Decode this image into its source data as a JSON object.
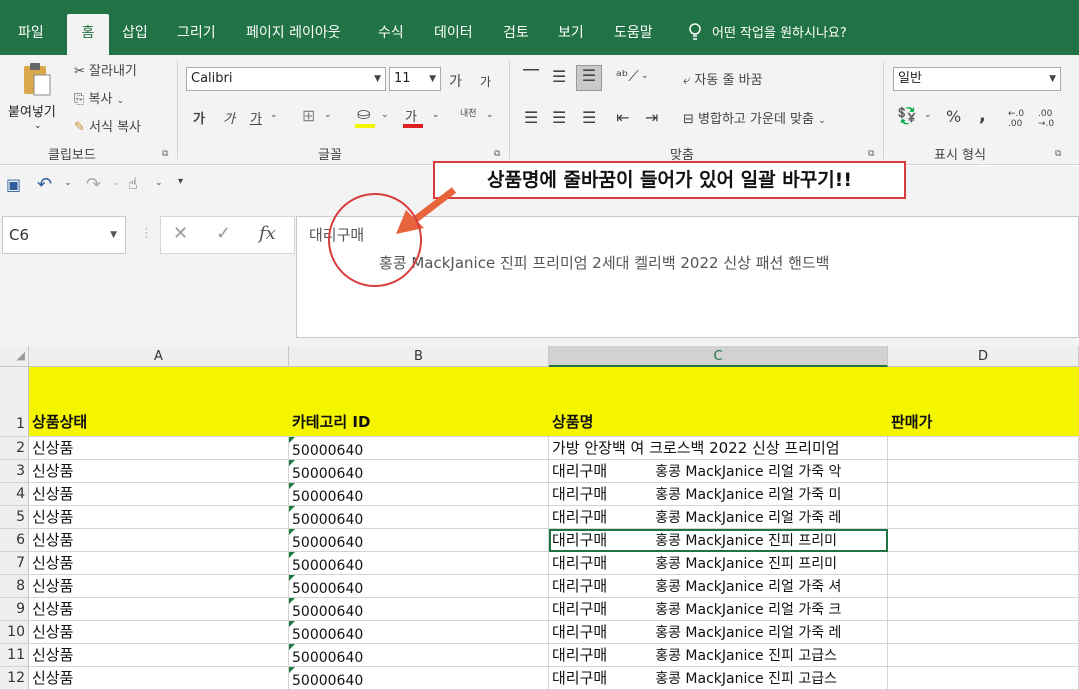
{
  "tabs": [
    "파일",
    "홈",
    "삽입",
    "그리기",
    "페이지 레이아웃",
    "수식",
    "데이터",
    "검토",
    "보기",
    "도움말"
  ],
  "tell_me": "어떤 작업을 원하시나요?",
  "ribbon": {
    "clipboard": {
      "paste": "붙여넣기",
      "cut": "잘라내기",
      "copy": "복사",
      "format_painter": "서식 복사",
      "label": "클립보드"
    },
    "font": {
      "name": "Calibri",
      "size": "11",
      "grow": "가",
      "shrink": "가",
      "bold": "가",
      "italic": "가",
      "underline": "가",
      "color_a": "가",
      "phonetic": "내천",
      "label": "글꼴"
    },
    "alignment": {
      "wrap": "자동 줄 바꿈",
      "merge": "병합하고 가운데 맞춤",
      "label": "맞춤"
    },
    "number": {
      "format": "일반",
      "percent": "%",
      "comma": ",",
      "inc": "←.0 .00",
      "dec": ".00 →.0",
      "label": "표시 형식"
    }
  },
  "name_box": "C6",
  "formula": {
    "line1": "대리구매",
    "line2": "홍콩 MackJanice 진피 프리미엄 2세대 켈리백 2022 신상 패션 핸드백"
  },
  "annotation": "상품명에 줄바꿈이 들어가 있어 일괄 바꾸기!!",
  "columns": [
    "A",
    "B",
    "C",
    "D"
  ],
  "header_row": {
    "num": "1",
    "a": "상품상태",
    "b": "카테고리 ID",
    "c": "상품명",
    "d": "판매가"
  },
  "rows": [
    {
      "num": "2",
      "a": "신상품",
      "b": "50000640",
      "c1": "가방 안장백 여 크로스백 2022 신상 프리미엄",
      "c2": ""
    },
    {
      "num": "3",
      "a": "신상품",
      "b": "50000640",
      "c1": "대리구매",
      "c2": "홍콩 MackJanice 리얼 가죽 악"
    },
    {
      "num": "4",
      "a": "신상품",
      "b": "50000640",
      "c1": "대리구매",
      "c2": "홍콩 MackJanice 리얼 가죽 미"
    },
    {
      "num": "5",
      "a": "신상품",
      "b": "50000640",
      "c1": "대리구매",
      "c2": "홍콩 MackJanice 리얼 가죽 레"
    },
    {
      "num": "6",
      "a": "신상품",
      "b": "50000640",
      "c1": "대리구매",
      "c2": "홍콩 MackJanice 진피 프리미"
    },
    {
      "num": "7",
      "a": "신상품",
      "b": "50000640",
      "c1": "대리구매",
      "c2": "홍콩 MackJanice 진피 프리미"
    },
    {
      "num": "8",
      "a": "신상품",
      "b": "50000640",
      "c1": "대리구매",
      "c2": "홍콩 MackJanice 리얼 가죽 셔"
    },
    {
      "num": "9",
      "a": "신상품",
      "b": "50000640",
      "c1": "대리구매",
      "c2": "홍콩 MackJanice 리얼 가죽 크"
    },
    {
      "num": "10",
      "a": "신상품",
      "b": "50000640",
      "c1": "대리구매",
      "c2": "홍콩 MackJanice 리얼 가죽 레"
    },
    {
      "num": "11",
      "a": "신상품",
      "b": "50000640",
      "c1": "대리구매",
      "c2": "홍콩 MackJanice 진피 고급스"
    },
    {
      "num": "12",
      "a": "신상품",
      "b": "50000640",
      "c1": "대리구매",
      "c2": "홍콩 MackJanice 진피 고급스"
    }
  ],
  "colors": {
    "excel_green": "#217346",
    "header_yellow": "#f5f500",
    "annotation_red": "#d83c3c"
  }
}
